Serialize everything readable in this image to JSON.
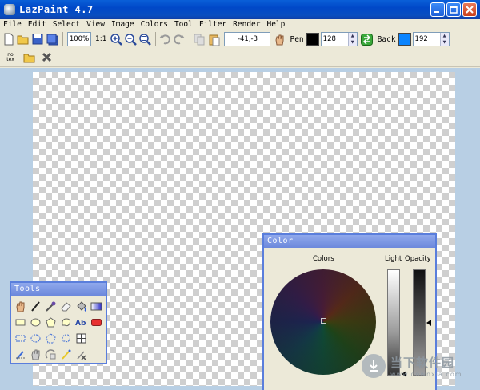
{
  "window": {
    "title": "LazPaint 4.7"
  },
  "menu": [
    "File",
    "Edit",
    "Select",
    "View",
    "Image",
    "Colors",
    "Tool",
    "Filter",
    "Render",
    "Help"
  ],
  "toolbar": {
    "zoom": "100%",
    "one_to_one": "1:1",
    "coords": "-41,-3",
    "pen_label": "Pen",
    "pen_color": "#000000",
    "pen_opacity": "128",
    "back_label": "Back",
    "back_color": "#0a84ff",
    "back_opacity": "192"
  },
  "toolbar2": {
    "notext_line1": "no",
    "notext_line2": "tex"
  },
  "tools_panel": {
    "title": "Tools"
  },
  "color_panel": {
    "title": "Color",
    "colors_label": "Colors",
    "light_label": "Light",
    "opacity_label": "Opacity"
  },
  "watermark": {
    "main": "当下软件园",
    "sub": "www.downxia.com"
  }
}
